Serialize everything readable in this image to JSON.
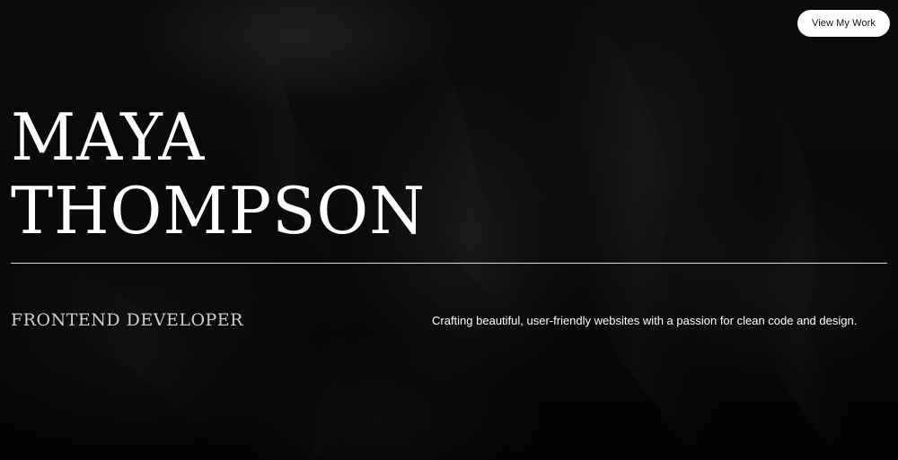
{
  "header": {
    "cta_label": "View My Work"
  },
  "hero": {
    "name_line1": "MAYA",
    "name_line2": "THOMPSON",
    "role": "FRONTEND DEVELOPER",
    "tagline": "Crafting beautiful, user-friendly websites with a passion for clean code and design."
  },
  "colors": {
    "background": "#050505",
    "text": "#ffffff",
    "button_bg": "#ffffff",
    "button_text": "#111111",
    "divider": "#d9d9d9"
  }
}
